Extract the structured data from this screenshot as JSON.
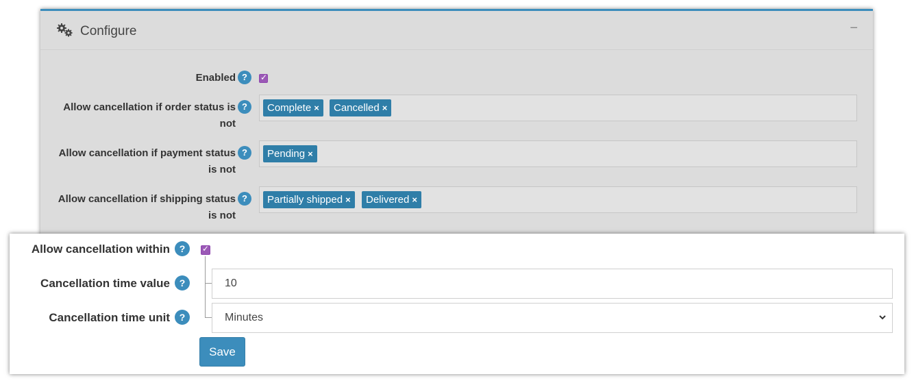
{
  "panel": {
    "title": "Configure",
    "collapse_label": "−",
    "icon": "gears-icon"
  },
  "help_glyph": "?",
  "settings": {
    "enabled": {
      "label": "Enabled",
      "checked": true
    },
    "order_status": {
      "label_line1": "Allow cancellation if order status is",
      "label_line2": "not",
      "tags": [
        "Complete",
        "Cancelled"
      ]
    },
    "payment_status": {
      "label_line1": "Allow cancellation if payment status",
      "label_line2": "is not",
      "tags": [
        "Pending"
      ]
    },
    "shipping_status": {
      "label_line1": "Allow cancellation if shipping status",
      "label_line2": "is not",
      "tags": [
        "Partially shipped",
        "Delivered"
      ]
    }
  },
  "front": {
    "allow_within": {
      "label": "Allow cancellation within",
      "checked": true
    },
    "time_value": {
      "label": "Cancellation time value",
      "value": "10"
    },
    "time_unit": {
      "label": "Cancellation time unit",
      "value": "Minutes"
    },
    "save_label": "Save"
  },
  "tag_remove_glyph": "×",
  "colors": {
    "accent": "#3c8dbc",
    "checkbox": "#9b59b6",
    "tag": "#2f7ea8"
  }
}
